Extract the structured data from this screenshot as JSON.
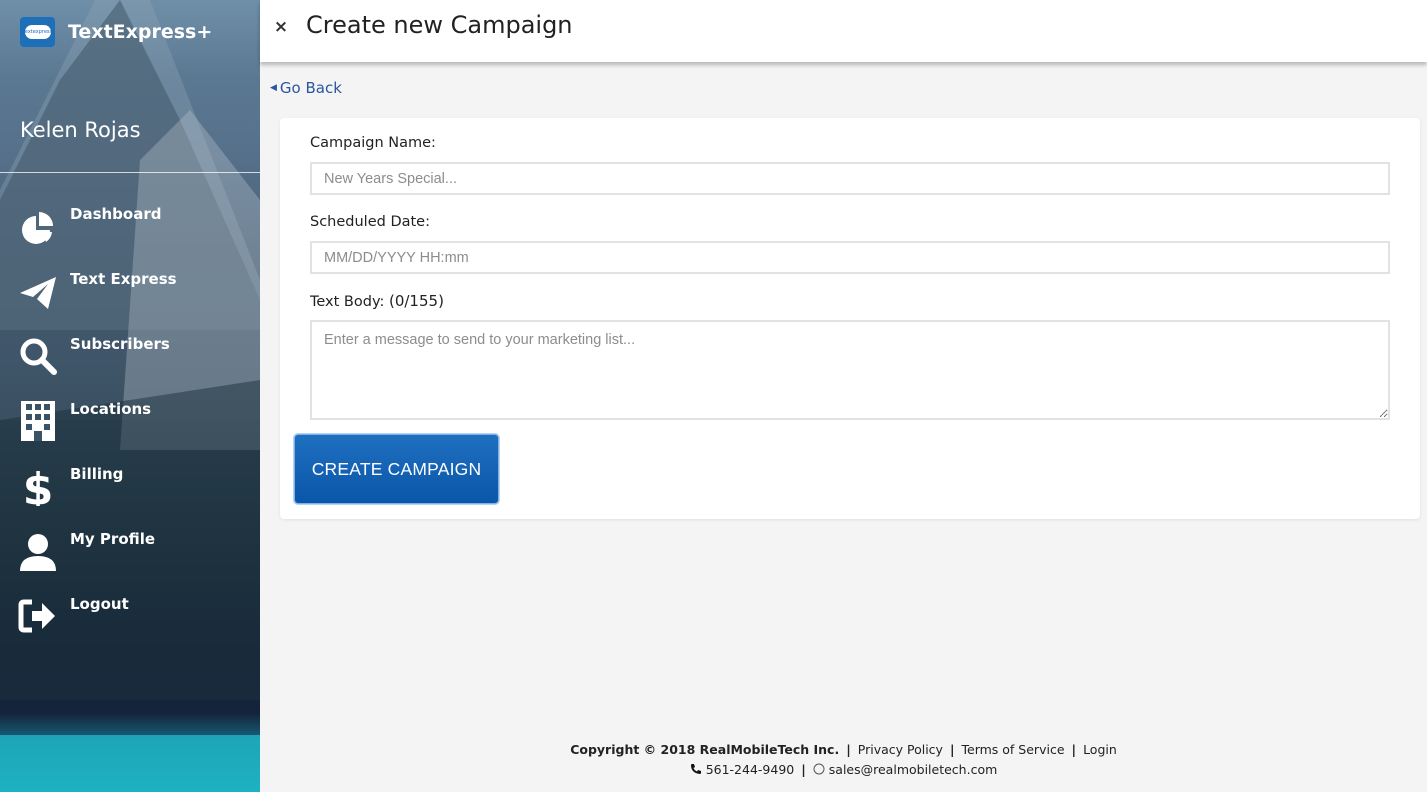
{
  "brand": {
    "name": "TextExpress+",
    "logo_text": "textexpress"
  },
  "user": {
    "name": "Kelen Rojas"
  },
  "nav": [
    {
      "label": "Dashboard",
      "icon": "pie-chart-icon"
    },
    {
      "label": "Text Express",
      "icon": "paper-plane-icon"
    },
    {
      "label": "Subscribers",
      "icon": "search-icon"
    },
    {
      "label": "Locations",
      "icon": "building-icon"
    },
    {
      "label": "Billing",
      "icon": "dollar-icon"
    },
    {
      "label": "My Profile",
      "icon": "user-icon"
    },
    {
      "label": "Logout",
      "icon": "logout-icon"
    }
  ],
  "header": {
    "close_symbol": "×",
    "title": "Create new Campaign"
  },
  "go_back": {
    "label": "Go Back"
  },
  "form": {
    "campaign_name_label": "Campaign Name:",
    "campaign_name_placeholder": "New Years Special...",
    "campaign_name_value": "",
    "scheduled_date_label": "Scheduled Date:",
    "scheduled_date_placeholder": "MM/DD/YYYY HH:mm",
    "scheduled_date_value": "",
    "text_body_label": "Text Body:",
    "text_body_count": "(0/155)",
    "text_body_placeholder": "Enter a message to send to your marketing list...",
    "text_body_value": "",
    "submit_label": "CREATE CAMPAIGN"
  },
  "footer": {
    "copyright": "Copyright © 2018 RealMobileTech Inc.",
    "links": [
      "Privacy Policy",
      "Terms of Service",
      "Login"
    ],
    "phone": "561-244-9490",
    "email": "sales@realmobiletech.com"
  },
  "colors": {
    "primary_button": "#0a56a8",
    "link": "#2a56a0",
    "background": "#f4f4f4"
  }
}
